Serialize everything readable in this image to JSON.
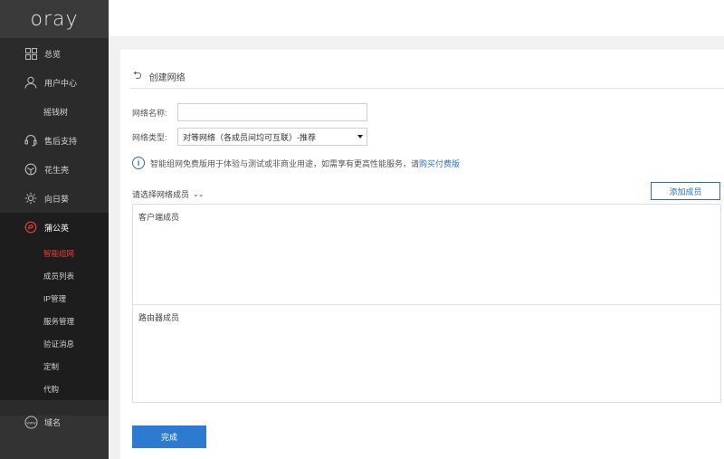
{
  "brand": {
    "logo_text": "oray"
  },
  "sidebar": {
    "items": [
      {
        "label": "总览",
        "icon": "grid-icon"
      },
      {
        "label": "用户中心",
        "icon": "user-icon"
      },
      {
        "label": "摇钱树",
        "icon": ""
      },
      {
        "label": "售后支持",
        "icon": "headset-icon"
      },
      {
        "label": "花生壳",
        "icon": "peanut-shell-icon"
      },
      {
        "label": "向日葵",
        "icon": "sunflower-icon"
      },
      {
        "label": "蒲公英",
        "icon": "dandelion-icon"
      }
    ],
    "pgy_sub": [
      {
        "label": "智能组网",
        "active": true
      },
      {
        "label": "成员列表"
      },
      {
        "label": "IP管理"
      },
      {
        "label": "服务管理"
      },
      {
        "label": "验证消息"
      },
      {
        "label": "定制"
      },
      {
        "label": "代购"
      }
    ],
    "domain": {
      "label": "域名",
      "icon": "www-icon"
    }
  },
  "page": {
    "back_icon": "back-arrow-icon",
    "title": "创建网络"
  },
  "form": {
    "name_label": "网络名称:",
    "name_value": "",
    "type_label": "网络类型:",
    "type_value": "对等网络（各成员间均可互联）-推荐"
  },
  "notice": {
    "text": "智能组网免费版用于体验与测试或非商业用途，如需享有更高性能服务，请",
    "link": "购买付费版"
  },
  "members": {
    "title": "请选择网络成员",
    "add_button": "添加成员",
    "client_section": "客户端成员",
    "router_section": "路由器成员"
  },
  "actions": {
    "done": "完成"
  },
  "colors": {
    "accent": "#2d7bd0",
    "active_red": "#e2403a",
    "sidebar_bg": "#2b2b2b"
  }
}
